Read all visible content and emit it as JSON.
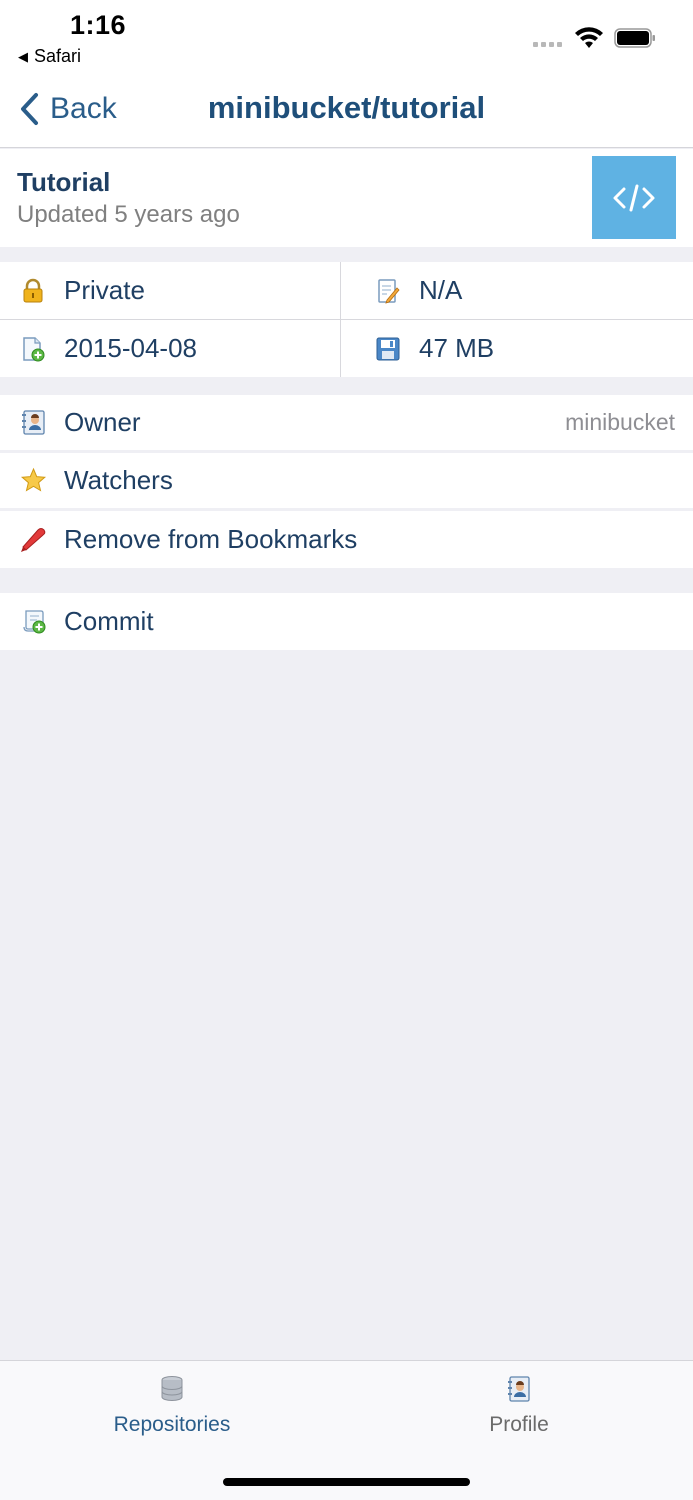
{
  "status_bar": {
    "time": "1:16",
    "back_app": "Safari"
  },
  "nav": {
    "back_label": "Back",
    "title": "minibucket/tutorial"
  },
  "repo": {
    "name": "Tutorial",
    "updated": "Updated 5 years ago",
    "code_icon": "code-icon"
  },
  "info": {
    "visibility": "Private",
    "language": "N/A",
    "created": "2015-04-08",
    "size": "47 MB"
  },
  "list_a": {
    "owner_label": "Owner",
    "owner_value": "minibucket",
    "watchers_label": "Watchers",
    "bookmark_label": "Remove from Bookmarks"
  },
  "list_b": {
    "commit_label": "Commit"
  },
  "tabs": {
    "repositories": "Repositories",
    "profile": "Profile"
  },
  "colors": {
    "accent": "#5fb2e3",
    "title": "#1f4f7a",
    "background": "#efeff4"
  }
}
